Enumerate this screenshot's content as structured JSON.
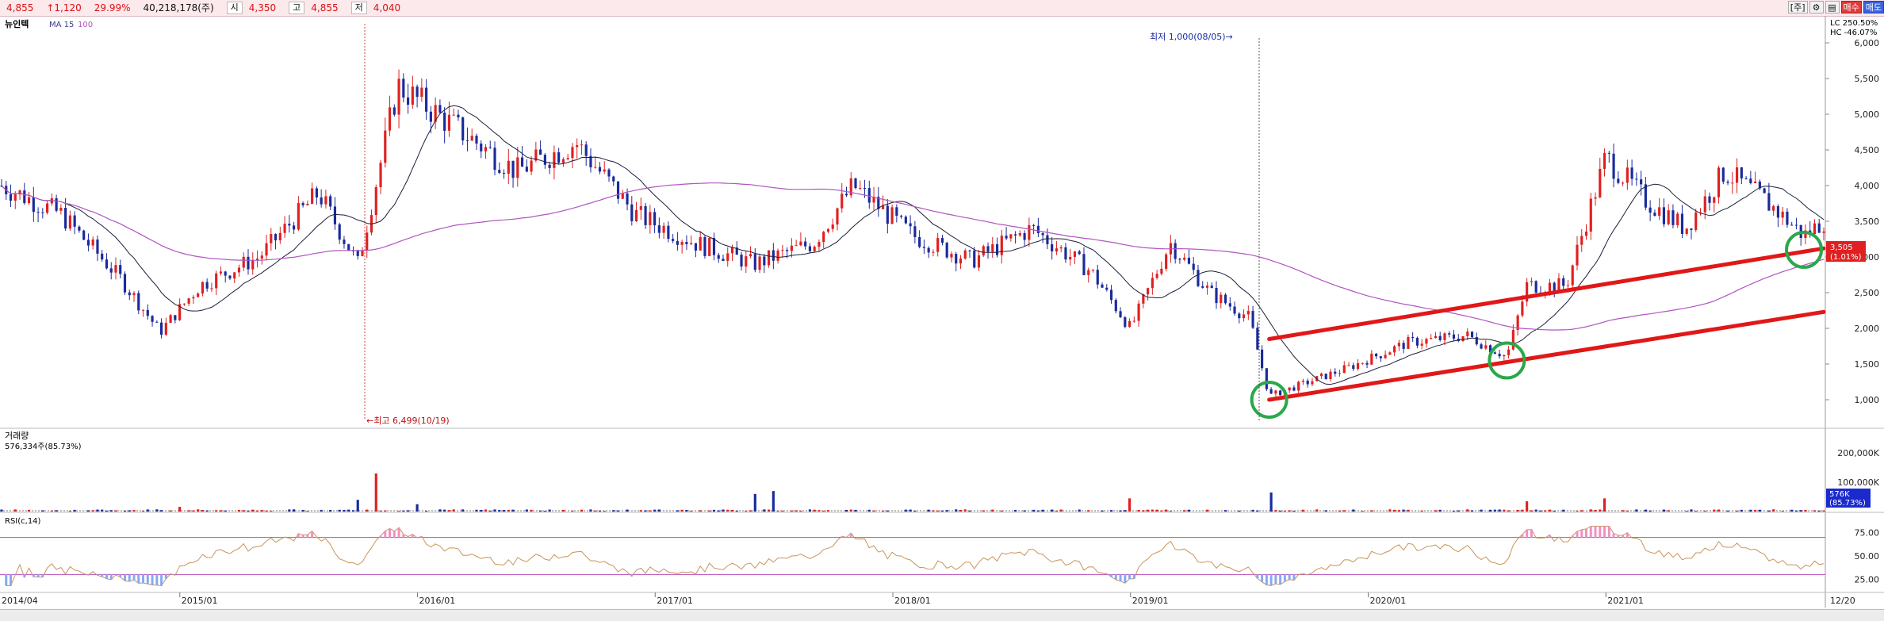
{
  "header": {
    "price": "4,855",
    "change": "↑1,120",
    "change_pct": "29.99%",
    "volume": "40,218,178(주)",
    "open_label": "시",
    "open": "4,350",
    "high_label": "고",
    "high": "4,855",
    "low_label": "저",
    "low": "4,040",
    "period_button": "[주]",
    "buy_label": "매수",
    "sell_label": "매도"
  },
  "colors": {
    "up": "#e02020",
    "down": "#1a2a9c",
    "ma15": "#1c1f3a",
    "ma100": "#b055c0",
    "trend": "#e01818",
    "circle": "#2aa84a",
    "rsi": "#c8945a",
    "rsi_band": "#c060c0"
  },
  "chart_data": [
    {
      "type": "candlestick",
      "title": "뉴인텍",
      "indicator_labels": [
        "MA 15",
        "100"
      ],
      "y_ticks": [
        "6,000",
        "5,500",
        "5,000",
        "4,500",
        "4,000",
        "3,500",
        "3,000",
        "2,500",
        "2,000",
        "1,500",
        "1,000"
      ],
      "ylim": [
        850,
        6600
      ],
      "x_ticks": [
        "2014/04",
        "2015/01",
        "2016/01",
        "2017/01",
        "2018/01",
        "2019/01",
        "2020/01",
        "2021/01",
        "12/20"
      ],
      "annotations": {
        "high_marker": "←최고 6,499(10/19)",
        "low_marker": "최저 1,000(08/05)→",
        "lc_label": "LC 250.50%",
        "hc_label": "HC -46.07%",
        "last_price": "3,505",
        "last_change": "(1.01%)"
      },
      "trend_lines": [
        {
          "from": [
            "2019/08",
            1850
          ],
          "to": [
            "2021/12",
            3120
          ]
        },
        {
          "from": [
            "2019/08",
            1000
          ],
          "to": [
            "2021/12",
            2230
          ]
        }
      ],
      "circles_at": [
        [
          "2019/08",
          1000
        ],
        [
          "2020/08",
          1550
        ],
        [
          "2021/11",
          3100
        ]
      ],
      "close_anchors": [
        [
          "2014/04",
          4000
        ],
        [
          "2014/07",
          3600
        ],
        [
          "2014/10",
          2700
        ],
        [
          "2014/12",
          1950
        ],
        [
          "2015/02",
          2600
        ],
        [
          "2015/05",
          3000
        ],
        [
          "2015/08",
          3900
        ],
        [
          "2015/10",
          2900
        ],
        [
          "2015/12",
          5400
        ],
        [
          "2016/03",
          4800
        ],
        [
          "2016/06",
          4200
        ],
        [
          "2016/09",
          4600
        ],
        [
          "2016/12",
          3600
        ],
        [
          "2017/03",
          3200
        ],
        [
          "2017/06",
          2900
        ],
        [
          "2017/09",
          3200
        ],
        [
          "2017/11",
          4000
        ],
        [
          "2018/02",
          3300
        ],
        [
          "2018/05",
          2950
        ],
        [
          "2018/08",
          3400
        ],
        [
          "2018/11",
          2800
        ],
        [
          "2019/01",
          2000
        ],
        [
          "2019/03",
          3200
        ],
        [
          "2019/05",
          2500
        ],
        [
          "2019/07",
          2150
        ],
        [
          "2019/08",
          1050
        ],
        [
          "2019/10",
          1250
        ],
        [
          "2019/12",
          1450
        ],
        [
          "2020/03",
          1800
        ],
        [
          "2020/06",
          1900
        ],
        [
          "2020/08",
          1600
        ],
        [
          "2020/09",
          2600
        ],
        [
          "2020/11",
          2600
        ],
        [
          "2021/01",
          4400
        ],
        [
          "2021/03",
          3800
        ],
        [
          "2021/05",
          3400
        ],
        [
          "2021/07",
          4200
        ],
        [
          "2021/09",
          3800
        ],
        [
          "2021/11",
          3300
        ],
        [
          "2021/12",
          3505
        ]
      ]
    },
    {
      "type": "bar",
      "title": "거래량",
      "summary": "576,334주(85.73%)",
      "y_ticks": [
        "200,000K",
        "100,000K"
      ],
      "last_value": "576K",
      "last_pct": "(85.73%)",
      "spikes": [
        [
          "2015/01",
          16000
        ],
        [
          "2015/10",
          40000
        ],
        [
          "2015/11",
          130000
        ],
        [
          "2016/01",
          25000
        ],
        [
          "2017/06",
          60000
        ],
        [
          "2017/07",
          70000
        ],
        [
          "2019/01",
          45000
        ],
        [
          "2019/08",
          65000
        ],
        [
          "2020/09",
          35000
        ],
        [
          "2021/01",
          45000
        ]
      ]
    },
    {
      "type": "line",
      "title": "RSI(c,14)",
      "y_ticks": [
        "75.00",
        "50.00",
        "25.00"
      ],
      "bands": [
        70,
        30
      ]
    }
  ]
}
